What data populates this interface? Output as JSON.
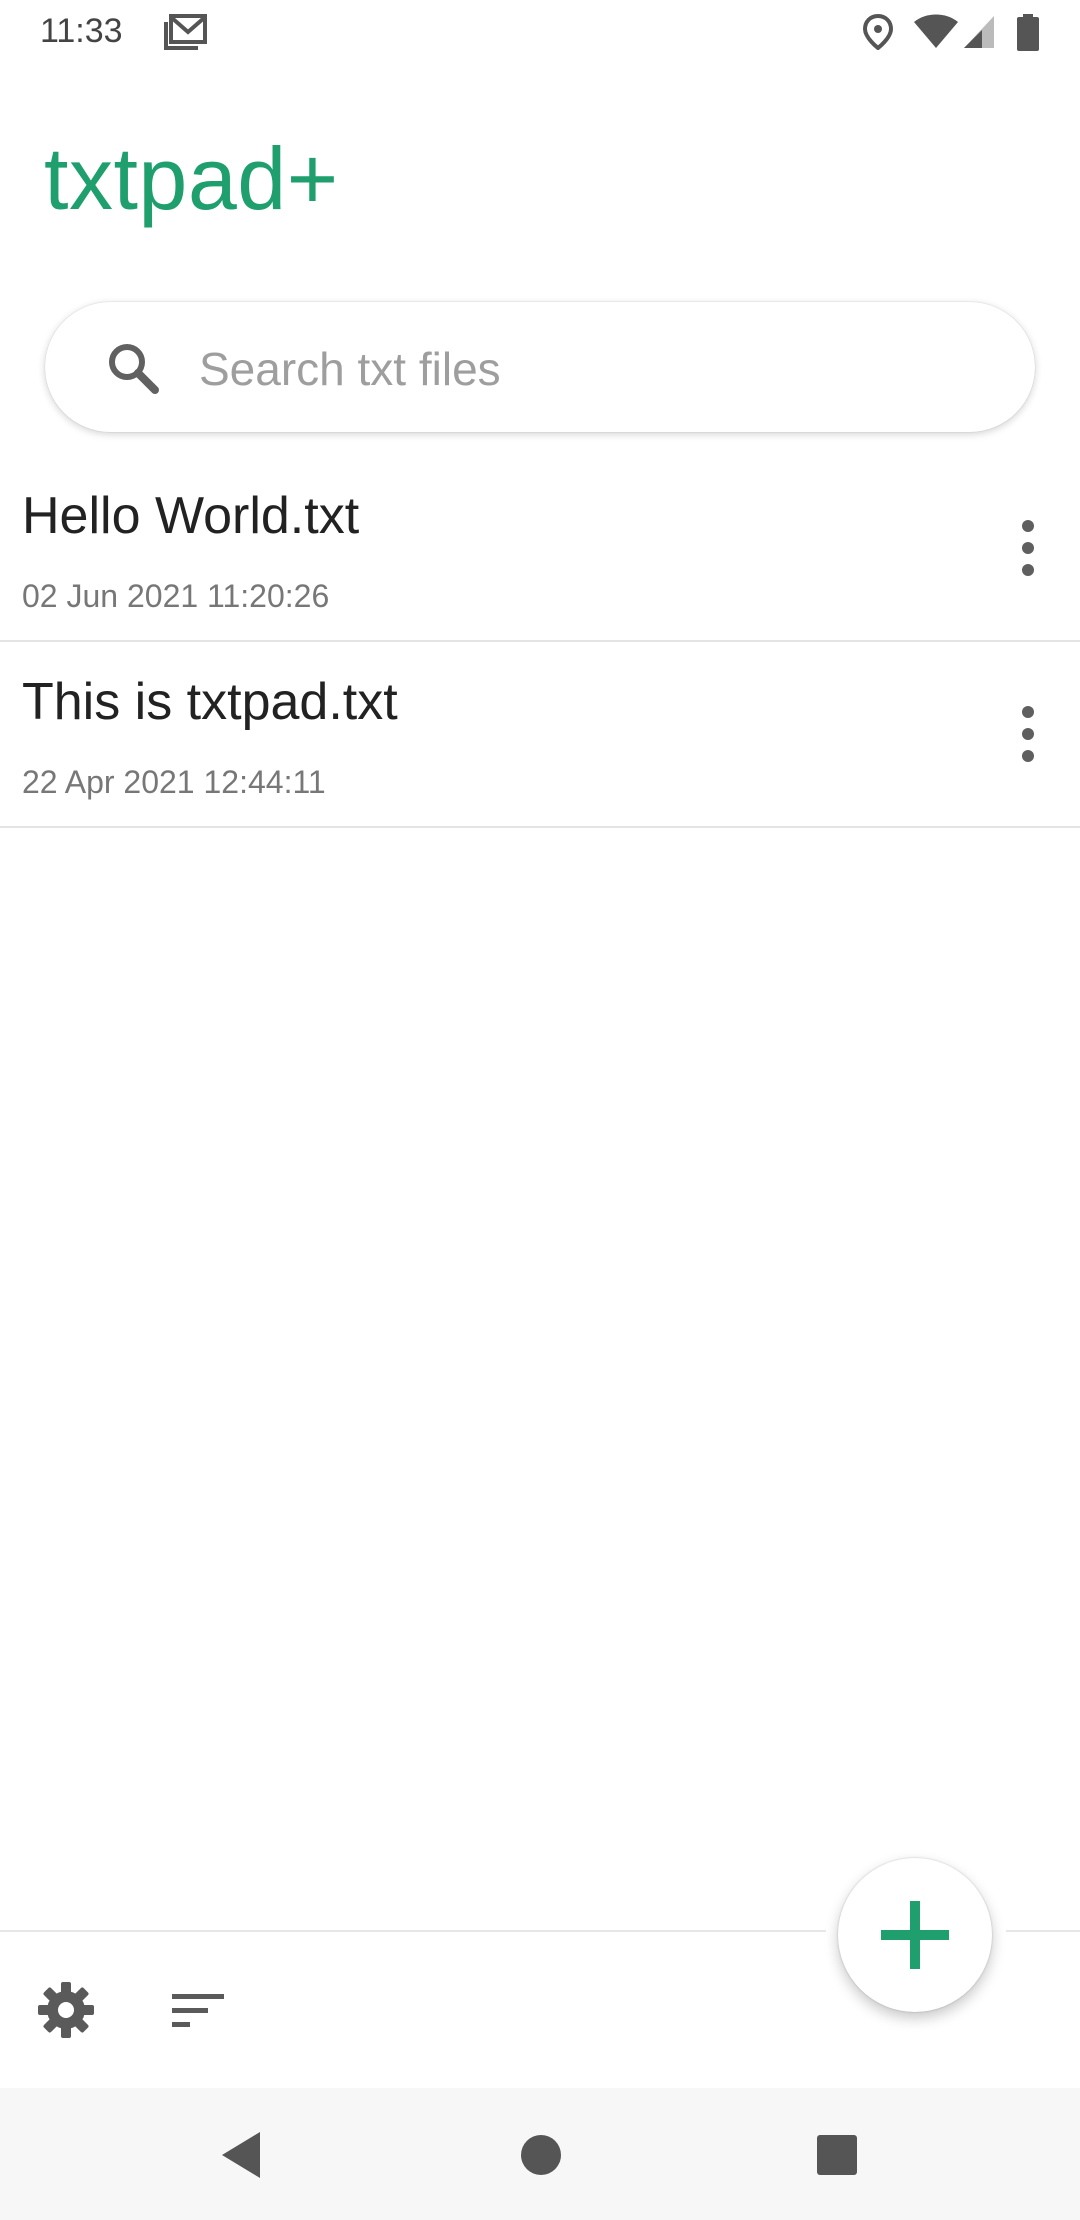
{
  "status_bar": {
    "time": "11:33",
    "icons": [
      "gmail-icon",
      "location-icon",
      "wifi-icon",
      "cellular-icon",
      "battery-icon"
    ]
  },
  "app": {
    "title": "txtpad+",
    "accent_color": "#1f9e6e"
  },
  "search": {
    "placeholder": "Search txt files",
    "value": "",
    "icon": "search-icon"
  },
  "files": [
    {
      "name": "Hello World.txt",
      "date": "02 Jun 2021 11:20:26"
    },
    {
      "name": "This is txtpad.txt",
      "date": "22 Apr 2021 12:44:11"
    }
  ],
  "bottom_bar": {
    "icons": [
      "gear-icon",
      "sort-icon"
    ],
    "fab_icon": "plus-icon"
  },
  "nav_bar": {
    "icons": [
      "back-icon",
      "home-icon",
      "recents-icon"
    ]
  }
}
